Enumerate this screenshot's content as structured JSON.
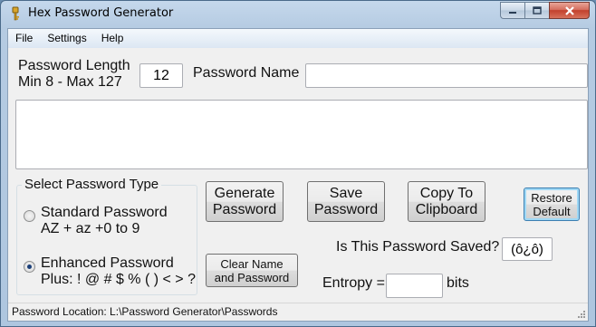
{
  "window": {
    "title": "Hex Password Generator",
    "icon": "key-icon",
    "controls": [
      "minimize-icon",
      "maximize-icon",
      "close-icon"
    ]
  },
  "menu": {
    "items": [
      "File",
      "Settings",
      "Help"
    ]
  },
  "password_length": {
    "label_line1": "Password Length",
    "label_line2": "Min 8 - Max 127",
    "value": "12"
  },
  "password_name": {
    "label": "Password Name",
    "value": ""
  },
  "output": {
    "value": ""
  },
  "password_type": {
    "title": "Select Password Type",
    "options": [
      {
        "line1": "Standard Password",
        "line2": "AZ + az +0 to 9",
        "checked": false
      },
      {
        "line1": "Enhanced Password",
        "line2": "Plus: ! @ # $ % ( ) < > ?",
        "checked": true
      }
    ]
  },
  "buttons": {
    "generate": "Generate\nPassword",
    "save": "Save\nPassword",
    "copy": "Copy To\nClipboard",
    "restore": "Restore\nDefault",
    "clear": "Clear Name\nand Password"
  },
  "saved_status": {
    "label": "Is This Password Saved?",
    "value": "(ô¿ô)"
  },
  "entropy": {
    "label": "Entropy =",
    "value": "",
    "unit": "bits"
  },
  "status_bar": {
    "text": "Password Location: L:\\Password Generator\\Passwords"
  },
  "colors": {
    "accent_focus": "#3c7fb1",
    "close_button": "#c2402c"
  }
}
